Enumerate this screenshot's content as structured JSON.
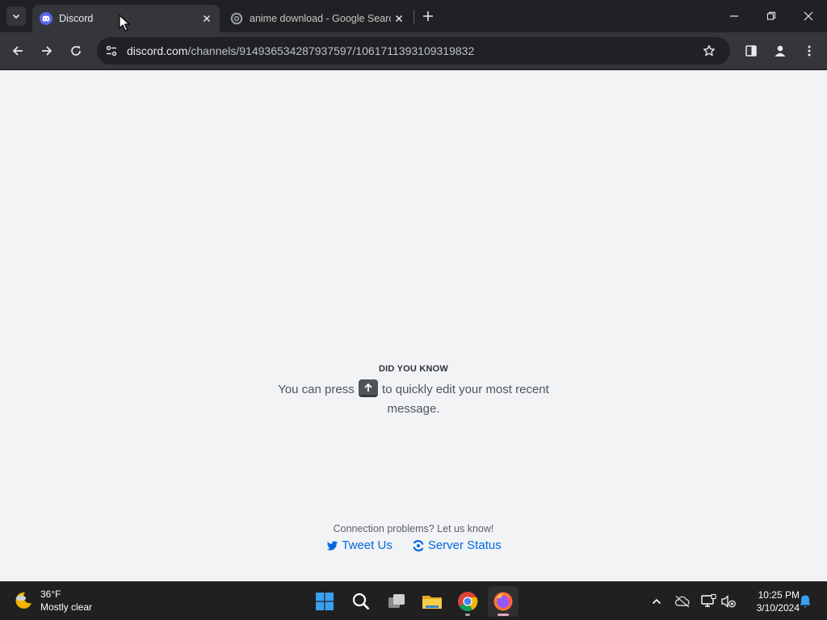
{
  "browser": {
    "tabs": [
      {
        "title": "Discord",
        "icon": "discord-logo-icon",
        "active": true
      },
      {
        "title": "anime download - Google Search",
        "icon": "google-search-icon",
        "active": false
      }
    ],
    "url": {
      "host": "discord.com",
      "path": "/channels/914936534287937597/1061711393109319832"
    }
  },
  "page": {
    "tip_heading": "DID YOU KNOW",
    "tip_text_before": "You can press",
    "tip_key": "arrow-up-icon",
    "tip_text_after": "to quickly edit your most recent message.",
    "connection_text": "Connection problems? Let us know!",
    "tweet_label": "Tweet Us",
    "status_label": "Server Status",
    "background_color": "#f2f3f5",
    "link_color": "#0068e0"
  },
  "taskbar": {
    "weather_temp": "36°F",
    "weather_condition": "Mostly clear",
    "apps": [
      "start-icon",
      "search-icon",
      "task-view-icon",
      "file-explorer-icon",
      "chrome-icon",
      "firefox-icon"
    ],
    "time": "10:25 PM",
    "date": "3/10/2024"
  }
}
